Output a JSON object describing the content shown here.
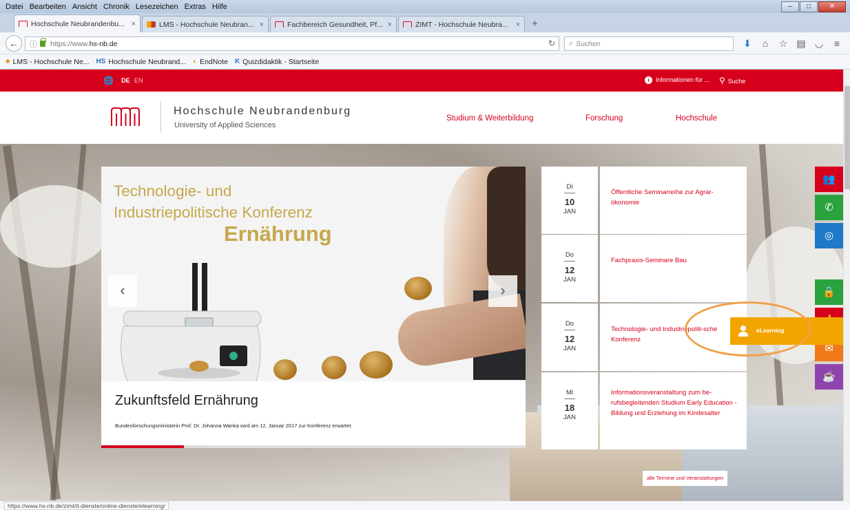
{
  "menu": [
    "Datei",
    "Bearbeiten",
    "Ansicht",
    "Chronik",
    "Lesezeichen",
    "Extras",
    "Hilfe"
  ],
  "tabs": [
    {
      "label": "Hochschule Neubrandenbu...",
      "active": true
    },
    {
      "label": "LMS - Hochschule Neubran...",
      "active": false
    },
    {
      "label": "Fachbereich Gesundheit, Pf...",
      "active": false
    },
    {
      "label": "ZIMT - Hochschule Neubra...",
      "active": false
    }
  ],
  "address": {
    "prefix": "https://www.",
    "domain": "hs-nb.de"
  },
  "search": {
    "placeholder": "Suchen"
  },
  "bookmarks": [
    {
      "label": "LMS - Hochschule Ne...",
      "icon": "lms"
    },
    {
      "label": "Hochschule Neubrand...",
      "icon": "hs"
    },
    {
      "label": "EndNote",
      "icon": "endnote"
    },
    {
      "label": "Quizdidaktik - Startseite",
      "icon": "quiz"
    }
  ],
  "topbar": {
    "lang_de": "DE",
    "lang_en": "EN",
    "info_label": "Informationen für ...",
    "search_label": "Suche"
  },
  "brand": {
    "name": "Hochschule Neubrandenburg",
    "tagline": "University of Applied Sciences"
  },
  "nav": [
    "Studium & Weiterbildung",
    "Forschung",
    "Hochschule"
  ],
  "slider": {
    "headline_line1": "Technologie- und",
    "headline_line2": "Industriepolitische Konferenz",
    "headline_line3": "Ernährung",
    "title": "Zukunftsfeld Ernährung",
    "caption": "Bundesforschungsministerin Prof. Dr. Johanna Wanka wird am 12. Januar 2017 zur Konferenz erwartet.",
    "prev": "‹",
    "next": "›"
  },
  "events": [
    {
      "weekday": "Di",
      "day": "10",
      "month": "JAN",
      "title": "Öffentliche Seminarreihe zur Agrar-ökonomie"
    },
    {
      "weekday": "Do",
      "day": "12",
      "month": "JAN",
      "title": "Fachpraxis-Seminare Bau"
    },
    {
      "weekday": "Do",
      "day": "12",
      "month": "JAN",
      "title": "Technologie- und Industriepoliti-sche Konferenz"
    },
    {
      "weekday": "Mi",
      "day": "18",
      "month": "JAN",
      "title": "Informationsveranstaltung zum be-rufsbegleitenden Studium Early Education - Bildung und Erziehung im Kindesalter"
    }
  ],
  "all_events_link": "alle Termine und Veranstaltungen",
  "side_icons": [
    {
      "name": "group-icon",
      "color": "#d6001c"
    },
    {
      "name": "whatsapp-icon",
      "color": "#2aa33e"
    },
    {
      "name": "compass-icon",
      "color": "#1f78c8"
    },
    {
      "name": "elearning-icon",
      "color": "#f2a500"
    },
    {
      "name": "lock-icon",
      "color": "#2aa33e"
    },
    {
      "name": "thumbs-up-icon",
      "color": "#d6001c"
    },
    {
      "name": "mail-icon",
      "color": "#f07a1a"
    },
    {
      "name": "coffee-icon",
      "color": "#8e44ad"
    }
  ],
  "elearning_label": "eLearning",
  "status_url": "https://www.hs-nb.de/zimt/it-dienste/online-dienste/elearning/",
  "colors": {
    "brand_red": "#d6001c",
    "gold": "#c6a74a",
    "elearning_orange": "#f2a500"
  }
}
